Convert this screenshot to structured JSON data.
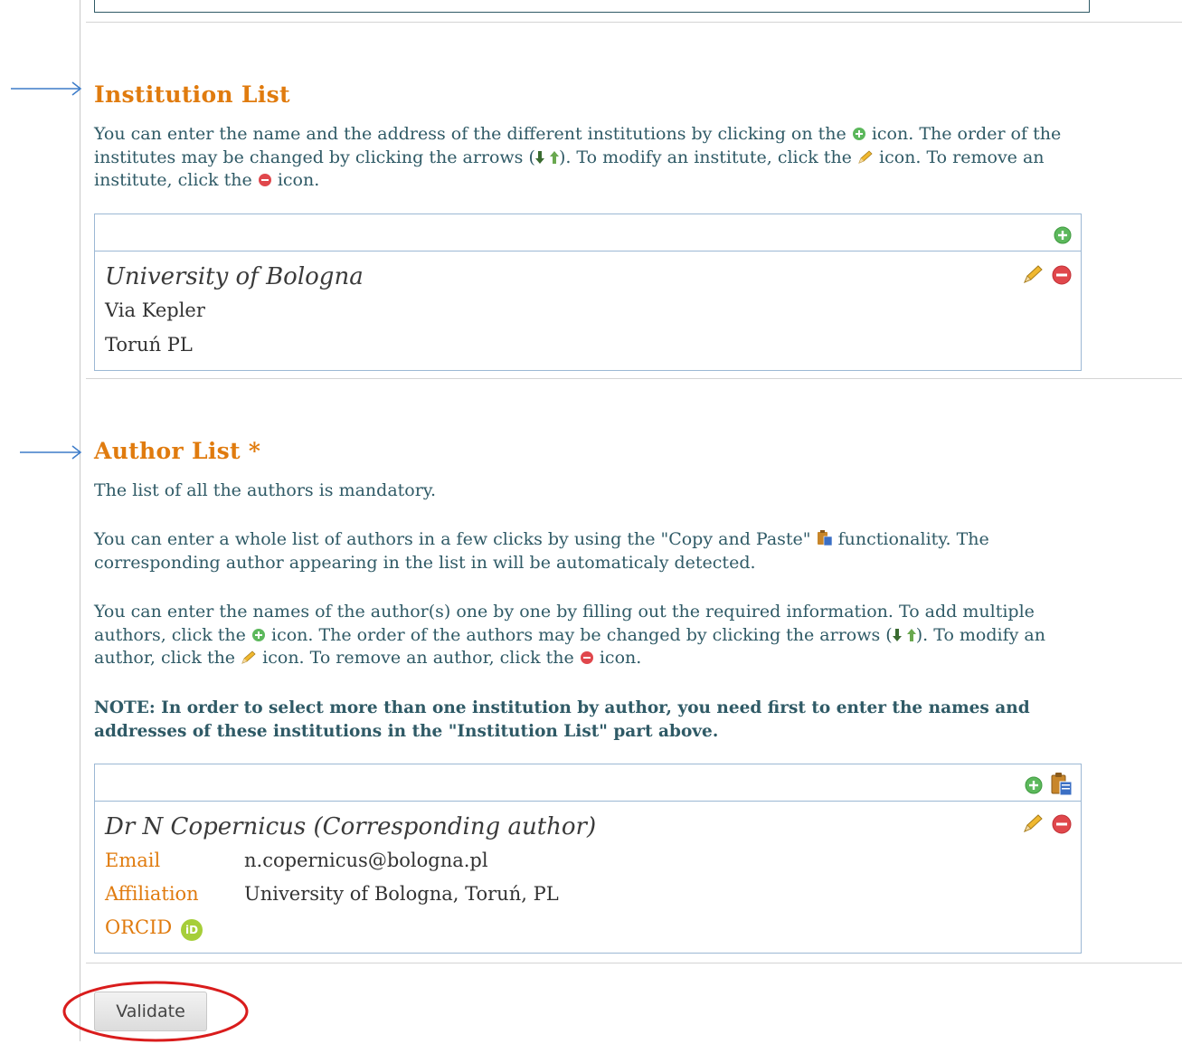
{
  "institution": {
    "title": "Institution List",
    "desc_p1": "You can enter the name and the address of the different institutions by clicking on the",
    "desc_p2": "icon. The order of the institutes may be changed by clicking the arrows (",
    "desc_p3": "). To modify an institute, click the",
    "desc_p4": "icon. To remove an institute, click the",
    "desc_p5": "icon.",
    "entry": {
      "name": "University of Bologna",
      "address1": "Via Kepler",
      "address2": "Toruń PL"
    }
  },
  "author": {
    "title": "Author List *",
    "mandatory_text": "The list of all the authors is mandatory.",
    "copy_p1": "You can enter a whole list of authors in a few clicks by using the \"Copy and Paste\"",
    "copy_p2": "functionality. The corresponding author appearing in the list in will be automaticaly detected.",
    "desc_p1": "You can enter the names of the author(s) one by one by filling out the required information. To add multiple authors, click the",
    "desc_p2": "icon. The order of the authors may be changed by clicking the arrows (",
    "desc_p3": "). To modify an author, click the",
    "desc_p4": "icon. To remove an author, click the",
    "desc_p5": "icon.",
    "note": "NOTE: In order to select more than one institution by author, you need first to enter the names and addresses of these institutions in the \"Institution List\" part above.",
    "entry": {
      "name": "Dr N Copernicus (Corresponding author)",
      "email_label": "Email",
      "email_value": "n.copernicus@bologna.pl",
      "affiliation_label": "Affiliation",
      "affiliation_value": "University of Bologna, Toruń, PL",
      "orcid_label": "ORCID",
      "orcid_icon_text": "iD"
    }
  },
  "validate_label": "Validate",
  "colors": {
    "accent": "#e07b0e",
    "text": "#2f5a66",
    "add_green": "#5cb85c",
    "remove_red": "#e0474c",
    "annotation_blue": "#3d7cc9",
    "annotation_red": "#d91c1c"
  }
}
